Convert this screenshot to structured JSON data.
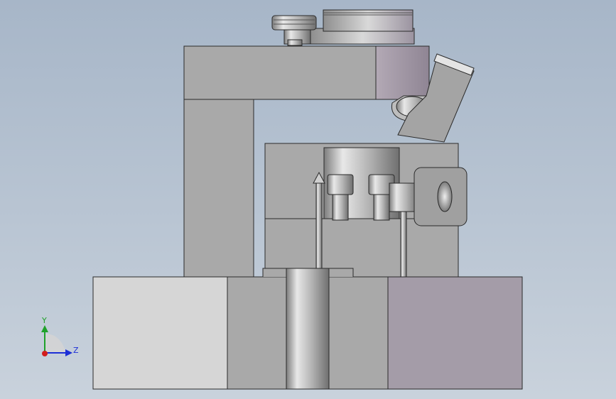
{
  "app": {
    "type": "cad-3d-viewport",
    "background_top": "#a7b6c8",
    "background_bottom": "#c9d2dc"
  },
  "triad": {
    "y_label": "Y",
    "z_label": "Z",
    "y_color": "#1fa12a",
    "z_color": "#1c2fd6",
    "x_color": "#d21c1c"
  },
  "model": {
    "edge_color": "#2a2a2a",
    "face_light": "#d6d6d6",
    "face_mid": "#a9a9a9",
    "face_purple": "#a49ca8"
  }
}
